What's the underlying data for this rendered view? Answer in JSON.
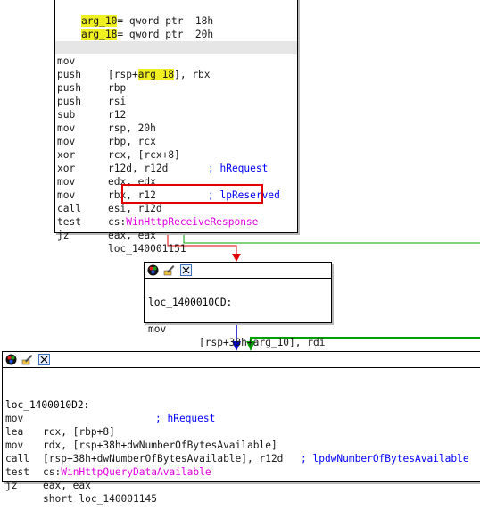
{
  "block_top": {
    "header": [
      {
        "label": "arg_10",
        "rest": "= qword ptr  18h"
      },
      {
        "label": "arg_18",
        "rest": "= qword ptr  20h"
      }
    ],
    "lines": [
      {
        "mn": "mov",
        "op": "[rsp+arg_18], rbx"
      },
      {
        "mn": "push",
        "op": "rbp"
      },
      {
        "mn": "push",
        "op": "rsi"
      },
      {
        "mn": "push",
        "op": "r12"
      },
      {
        "mn": "sub",
        "op": "rsp, 20h"
      },
      {
        "mn": "mov",
        "op": "rbp, rcx"
      },
      {
        "mn": "mov",
        "op": "rcx, [rcx+8]",
        "comment": "; hRequest"
      },
      {
        "mn": "xor",
        "op": "r12d, r12d"
      },
      {
        "mn": "xor",
        "op": "edx, edx",
        "comment": "; lpReserved"
      },
      {
        "mn": "mov",
        "op": "rbx, r12"
      },
      {
        "mn": "mov",
        "op": "esi, r12d"
      },
      {
        "mn": "call",
        "op_prefix": "cs:",
        "op_fn": "WinHttpReceiveResponse"
      },
      {
        "mn": "test",
        "op": "eax, eax"
      },
      {
        "mn": "jz",
        "op": "loc_140001151"
      }
    ]
  },
  "block_mid": {
    "label": "loc_1400010CD:",
    "line": {
      "mn": "mov",
      "op": "[rsp+38h+arg_10], rdi"
    }
  },
  "block_bottom": {
    "label": "loc_1400010D2:",
    "label_comment": "; hRequest",
    "lines": [
      {
        "mn": "mov",
        "op": "rcx, [rbp+8]"
      },
      {
        "mn": "lea",
        "op": "rdx, [rsp+38h+dwNumberOfBytesAvailable]",
        "comment": "; lpdwNumberOfBytesAvailable"
      },
      {
        "mn": "mov",
        "op": "[rsp+38h+dwNumberOfBytesAvailable], r12d"
      },
      {
        "mn": "call",
        "op_prefix": "cs:",
        "op_fn": "WinHttpQueryDataAvailable"
      },
      {
        "mn": "test",
        "op": "eax, eax"
      },
      {
        "mn": "jz",
        "op": "short loc_140001145"
      }
    ]
  },
  "toolbar_icons": [
    "color-palette-icon",
    "edit-pencil-icon",
    "graph-nodes-icon"
  ],
  "colors": {
    "highlight_box": "#e00000",
    "edge_true": "#00a000",
    "edge_false": "#e00000",
    "edge_flow": "#0000cc"
  }
}
